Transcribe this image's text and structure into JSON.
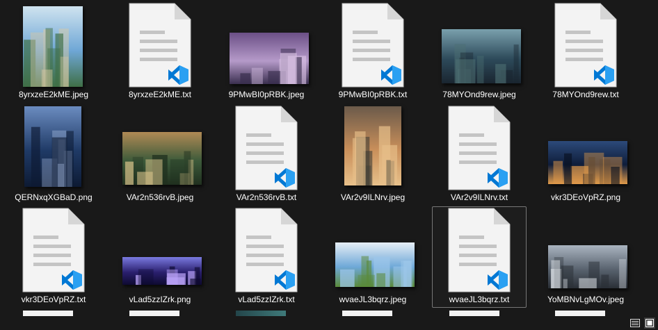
{
  "files": [
    {
      "name": "8yrxzeE2kME.jpeg",
      "kind": "image",
      "icon": "image-thumbnail",
      "colors": [
        "#6fa7d6",
        "#cfe3ef",
        "#3f6f46",
        "#d9c9a4"
      ]
    },
    {
      "name": "8yrxzeE2kME.txt",
      "kind": "text",
      "icon": "vscode-text-file-icon"
    },
    {
      "name": "9PMwBI0pRBK.jpeg",
      "kind": "image",
      "icon": "image-thumbnail",
      "colors": [
        "#b59ac9",
        "#6b4f86",
        "#3a2f4f",
        "#d8c0e3"
      ]
    },
    {
      "name": "9PMwBI0pRBK.txt",
      "kind": "text",
      "icon": "vscode-text-file-icon"
    },
    {
      "name": "78MYOnd9rew.jpeg",
      "kind": "image",
      "icon": "image-thumbnail",
      "colors": [
        "#2d4a5a",
        "#7aa0ad",
        "#1a2530",
        "#4d6f73"
      ]
    },
    {
      "name": "78MYOnd9rew.txt",
      "kind": "text",
      "icon": "vscode-text-file-icon"
    },
    {
      "name": "QERNxqXGBaD.png",
      "kind": "image",
      "icon": "image-thumbnail",
      "colors": [
        "#1f3a66",
        "#6b8cc0",
        "#0d1a33",
        "#a3b8de"
      ]
    },
    {
      "name": "VAr2n536rvB.jpeg",
      "kind": "image",
      "icon": "image-thumbnail",
      "colors": [
        "#3c5a3a",
        "#b08a55",
        "#20301f",
        "#d8c38a"
      ]
    },
    {
      "name": "VAr2n536rvB.txt",
      "kind": "text",
      "icon": "vscode-text-file-icon"
    },
    {
      "name": "VAr2v9ILNrv.jpeg",
      "kind": "image",
      "icon": "image-thumbnail",
      "colors": [
        "#c98f5a",
        "#6b5a4a",
        "#e7c08a",
        "#3b3a33"
      ]
    },
    {
      "name": "VAr2v9ILNrv.txt",
      "kind": "text",
      "icon": "vscode-text-file-icon"
    },
    {
      "name": "vkr3DEoVpRZ.png",
      "kind": "image",
      "icon": "image-thumbnail",
      "colors": [
        "#0f1d3a",
        "#2c4a7a",
        "#e09a4a",
        "#08101f"
      ]
    },
    {
      "name": "vkr3DEoVpRZ.txt",
      "kind": "text",
      "icon": "vscode-text-file-icon"
    },
    {
      "name": "vLad5zzIZrk.png",
      "kind": "image",
      "icon": "image-thumbnail",
      "colors": [
        "#2a1f6e",
        "#7a7ae0",
        "#0e0a30",
        "#c0a8ff"
      ]
    },
    {
      "name": "vLad5zzIZrk.txt",
      "kind": "text",
      "icon": "vscode-text-file-icon"
    },
    {
      "name": "wvaeJL3bqrz.jpeg",
      "kind": "image",
      "icon": "image-thumbnail",
      "colors": [
        "#6ea8d8",
        "#e6eef5",
        "#5a8a3a",
        "#9cc6ea"
      ]
    },
    {
      "name": "wvaeJL3bqrz.txt",
      "kind": "text",
      "icon": "vscode-text-file-icon",
      "selected": true
    },
    {
      "name": "YoMBNvLgMOv.jpeg",
      "kind": "image",
      "icon": "image-thumbnail",
      "colors": [
        "#5a6470",
        "#aab4c0",
        "#2a2f36",
        "#d8dde3"
      ]
    }
  ],
  "status_bar": {
    "view_buttons": [
      {
        "icon": "details-view-icon"
      },
      {
        "icon": "large-icons-view-icon",
        "active": true
      }
    ]
  },
  "colors": {
    "background": "#191919",
    "doc_fill": "#f3f3f3",
    "doc_fold": "#d6d6d6",
    "doc_lines": "#c4c4c4",
    "vscode_blue": "#0078d4",
    "vscode_light": "#2aa0f2",
    "selection_border": "#777777"
  }
}
